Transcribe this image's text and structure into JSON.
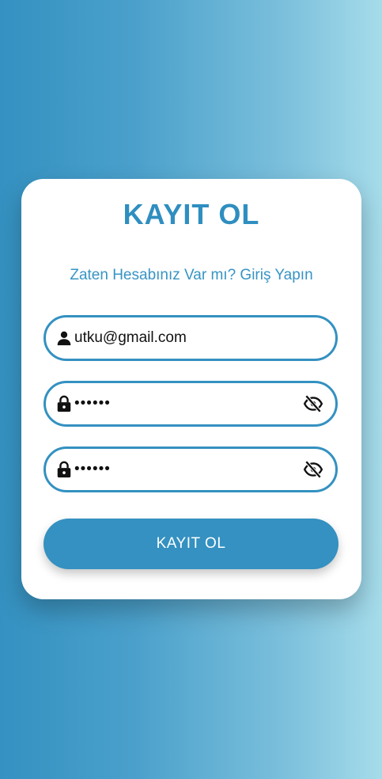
{
  "form": {
    "title": "KAYIT OL",
    "login_link": "Zaten Hesabınız Var mı? Giriş Yapın",
    "email": {
      "value": "utku@gmail.com",
      "icon": "person-icon"
    },
    "password": {
      "value": "123456",
      "icon": "lock-icon",
      "toggle_icon": "eye-off-icon"
    },
    "password_confirm": {
      "value": "123456",
      "icon": "lock-icon",
      "toggle_icon": "eye-off-icon"
    },
    "submit_label": "KAYIT OL"
  },
  "colors": {
    "accent": "#3491c1",
    "card": "#ffffff",
    "gradient_start": "#3491c1",
    "gradient_end": "#a6dcea"
  }
}
